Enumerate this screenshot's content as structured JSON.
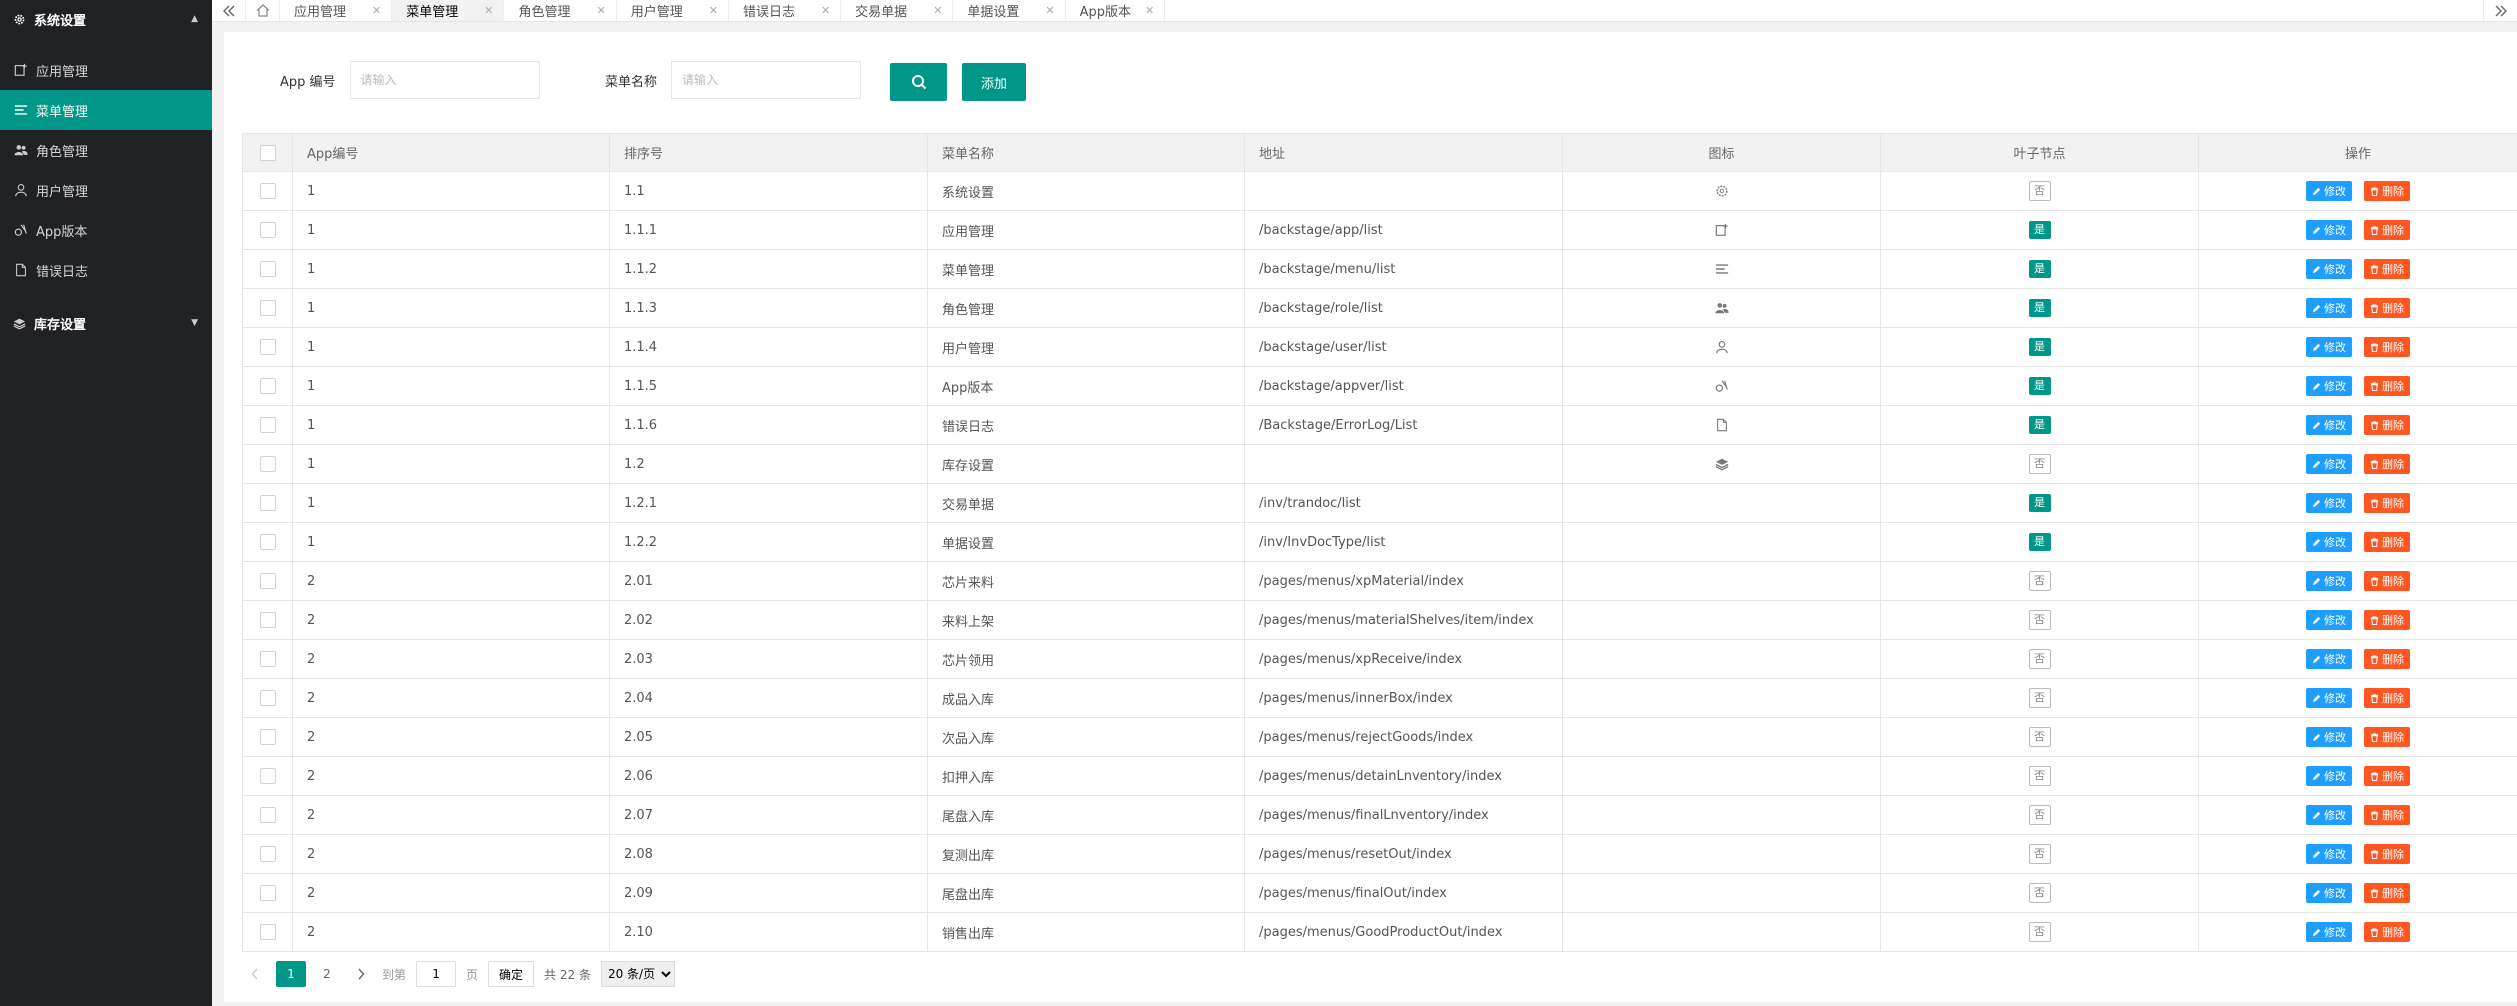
{
  "sidebar": {
    "group1": {
      "label": "系统设置"
    },
    "items": [
      {
        "label": "应用管理",
        "icon": "app-icon"
      },
      {
        "label": "菜单管理",
        "icon": "menu-lines-icon"
      },
      {
        "label": "角色管理",
        "icon": "users-icon"
      },
      {
        "label": "用户管理",
        "icon": "user-icon"
      },
      {
        "label": "App版本",
        "icon": "version-icon"
      },
      {
        "label": "错误日志",
        "icon": "file-icon"
      }
    ],
    "group2": {
      "label": "库存设置"
    }
  },
  "tabs": [
    {
      "label": "应用管理"
    },
    {
      "label": "菜单管理"
    },
    {
      "label": "角色管理"
    },
    {
      "label": "用户管理"
    },
    {
      "label": "错误日志"
    },
    {
      "label": "交易单据"
    },
    {
      "label": "单据设置"
    },
    {
      "label": "App版本"
    }
  ],
  "search": {
    "app_label": "App 编号",
    "app_placeholder": "请输入",
    "name_label": "菜单名称",
    "name_placeholder": "请输入",
    "add_label": "添加"
  },
  "table": {
    "headers": [
      "App编号",
      "排序号",
      "菜单名称",
      "地址",
      "图标",
      "叶子节点",
      "操作"
    ],
    "edit_label": "修改",
    "delete_label": "删除",
    "rows": [
      {
        "app": "1",
        "sort": "1.1",
        "name": "系统设置",
        "url": "",
        "icon": "gear-icon",
        "leaf": "否"
      },
      {
        "app": "1",
        "sort": "1.1.1",
        "name": "应用管理",
        "url": "/backstage/app/list",
        "icon": "app-icon",
        "leaf": "是"
      },
      {
        "app": "1",
        "sort": "1.1.2",
        "name": "菜单管理",
        "url": "/backstage/menu/list",
        "icon": "menu-lines-icon",
        "leaf": "是"
      },
      {
        "app": "1",
        "sort": "1.1.3",
        "name": "角色管理",
        "url": "/backstage/role/list",
        "icon": "users-icon",
        "leaf": "是"
      },
      {
        "app": "1",
        "sort": "1.1.4",
        "name": "用户管理",
        "url": "/backstage/user/list",
        "icon": "user-icon",
        "leaf": "是"
      },
      {
        "app": "1",
        "sort": "1.1.5",
        "name": "App版本",
        "url": "/backstage/appver/list",
        "icon": "version-icon",
        "leaf": "是"
      },
      {
        "app": "1",
        "sort": "1.1.6",
        "name": "错误日志",
        "url": "/Backstage/ErrorLog/List",
        "icon": "file-icon",
        "leaf": "是"
      },
      {
        "app": "1",
        "sort": "1.2",
        "name": "库存设置",
        "url": "",
        "icon": "layers-icon",
        "leaf": "否"
      },
      {
        "app": "1",
        "sort": "1.2.1",
        "name": "交易单据",
        "url": "/inv/trandoc/list",
        "icon": "",
        "leaf": "是"
      },
      {
        "app": "1",
        "sort": "1.2.2",
        "name": "单据设置",
        "url": "/inv/InvDocType/list",
        "icon": "",
        "leaf": "是"
      },
      {
        "app": "2",
        "sort": "2.01",
        "name": "芯片来料",
        "url": "/pages/menus/xpMaterial/index",
        "icon": "",
        "leaf": "否"
      },
      {
        "app": "2",
        "sort": "2.02",
        "name": "来料上架",
        "url": "/pages/menus/materialShelves/item/index",
        "icon": "",
        "leaf": "否"
      },
      {
        "app": "2",
        "sort": "2.03",
        "name": "芯片领用",
        "url": "/pages/menus/xpReceive/index",
        "icon": "",
        "leaf": "否"
      },
      {
        "app": "2",
        "sort": "2.04",
        "name": "成品入库",
        "url": "/pages/menus/innerBox/index",
        "icon": "",
        "leaf": "否"
      },
      {
        "app": "2",
        "sort": "2.05",
        "name": "次品入库",
        "url": "/pages/menus/rejectGoods/index",
        "icon": "",
        "leaf": "否"
      },
      {
        "app": "2",
        "sort": "2.06",
        "name": "扣押入库",
        "url": "/pages/menus/detainLnventory/index",
        "icon": "",
        "leaf": "否"
      },
      {
        "app": "2",
        "sort": "2.07",
        "name": "尾盘入库",
        "url": "/pages/menus/finalLnventory/index",
        "icon": "",
        "leaf": "否"
      },
      {
        "app": "2",
        "sort": "2.08",
        "name": "复测出库",
        "url": "/pages/menus/resetOut/index",
        "icon": "",
        "leaf": "否"
      },
      {
        "app": "2",
        "sort": "2.09",
        "name": "尾盘出库",
        "url": "/pages/menus/finalOut/index",
        "icon": "",
        "leaf": "否"
      },
      {
        "app": "2",
        "sort": "2.10",
        "name": "销售出库",
        "url": "/pages/menus/GoodProductOut/index",
        "icon": "",
        "leaf": "否"
      }
    ]
  },
  "pager": {
    "pages": [
      "1",
      "2"
    ],
    "goto_label": "到第",
    "goto_value": "1",
    "page_unit": "页",
    "confirm_label": "确定",
    "total_label": "共 22 条",
    "page_size": "20 条/页"
  },
  "colors": {
    "primary": "#009688",
    "sidebar": "#1f2124",
    "edit": "#1e9fff",
    "delete": "#ff5722"
  }
}
